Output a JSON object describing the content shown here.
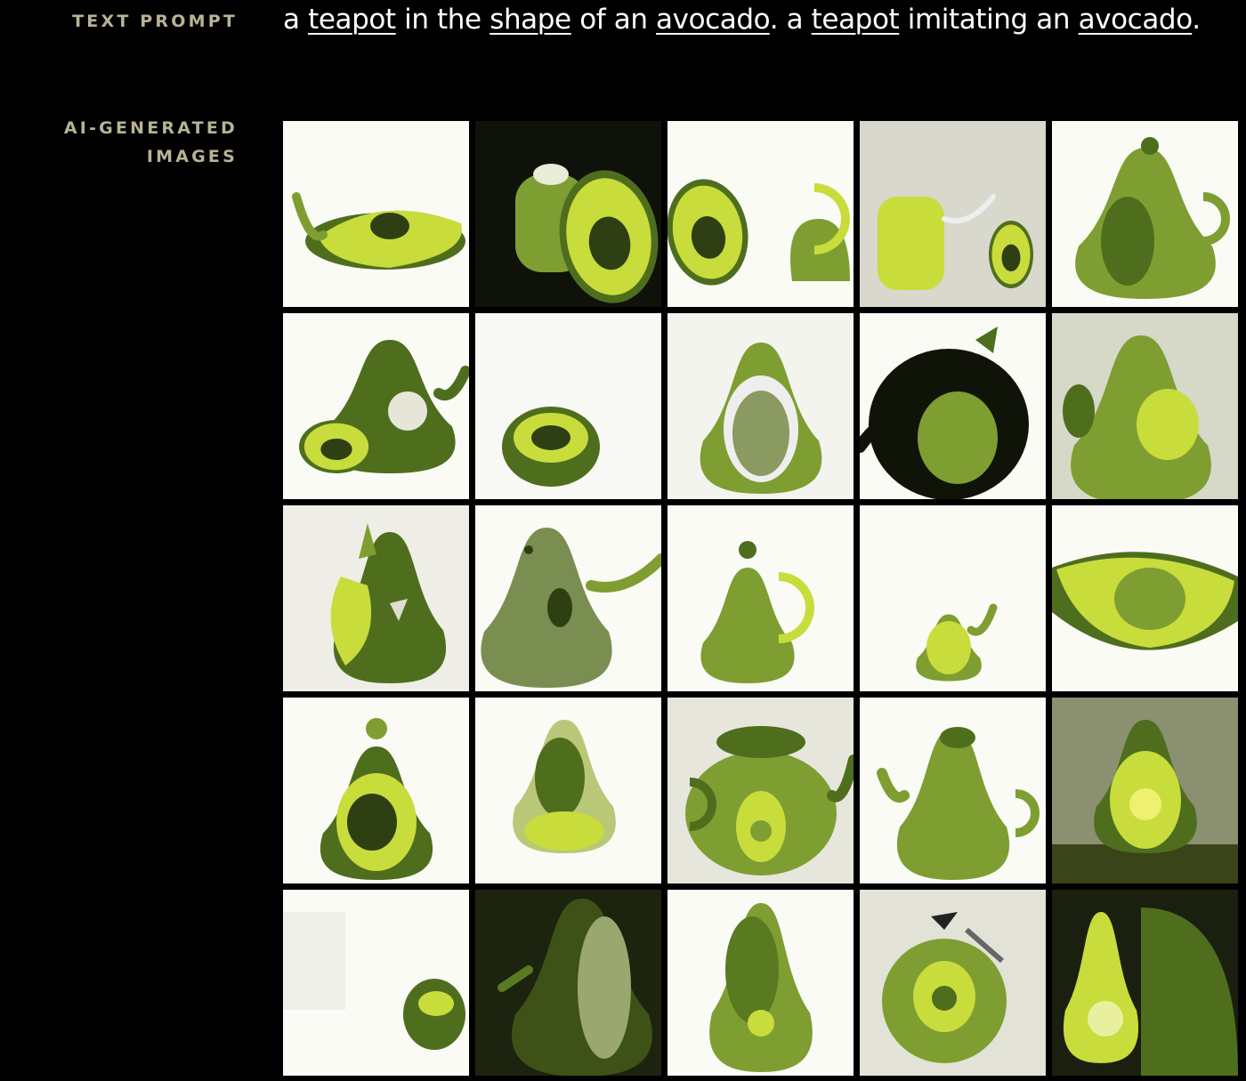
{
  "labels": {
    "text_prompt": "TEXT PROMPT",
    "ai_generated_line1": "AI-GENERATED",
    "ai_generated_line2": "IMAGES"
  },
  "prompt": {
    "tokens": [
      {
        "text": "a ",
        "link": false
      },
      {
        "text": "teapot",
        "link": true
      },
      {
        "text": " in the ",
        "link": false
      },
      {
        "text": "shape",
        "link": true
      },
      {
        "text": " of an ",
        "link": false
      },
      {
        "text": "avocado",
        "link": true
      },
      {
        "text": ". a ",
        "link": false
      },
      {
        "text": "teapot",
        "link": true
      },
      {
        "text": " imitating an ",
        "link": false
      },
      {
        "text": "avocado",
        "link": true
      },
      {
        "text": ".",
        "link": false
      }
    ]
  },
  "colors": {
    "background": "#000000",
    "label": "#b7b394",
    "prompt_text": "#ffffff",
    "avocado_light": "#c8dc3c",
    "avocado_mid": "#7e9e32",
    "avocado_dark": "#4e6e1e",
    "pit": "#2f3f14"
  },
  "images": [
    {
      "bg": "#fbfbf6",
      "variant": "flat-teapot"
    },
    {
      "bg": "#0e120a",
      "variant": "half-avocado-with-pot"
    },
    {
      "bg": "#fbfbf6",
      "variant": "split-avocado-handle"
    },
    {
      "bg": "#d9d8cc",
      "variant": "kettle-and-half"
    },
    {
      "bg": "#fbfbf6",
      "variant": "tall-pot-lid"
    },
    {
      "bg": "#fbfbf6",
      "variant": "pot-with-half"
    },
    {
      "bg": "#f8f8f4",
      "variant": "round-cup"
    },
    {
      "bg": "#f4f4ee",
      "variant": "open-shell"
    },
    {
      "bg": "#fbfbf6",
      "variant": "dark-teapot"
    },
    {
      "bg": "#d6d8c8",
      "variant": "gourd-vase"
    },
    {
      "bg": "#eeeee6",
      "variant": "leaf-pot"
    },
    {
      "bg": "#fbfbf6",
      "variant": "lumpy-spout"
    },
    {
      "bg": "#fbfbf6",
      "variant": "pear-handle"
    },
    {
      "bg": "#fbfbf6",
      "variant": "small-spout"
    },
    {
      "bg": "#fbfbf6",
      "variant": "bowl-half"
    },
    {
      "bg": "#fbfbf6",
      "variant": "jar-lid"
    },
    {
      "bg": "#fbfbf6",
      "variant": "egg-shell"
    },
    {
      "bg": "#e6e6dc",
      "variant": "big-teapot"
    },
    {
      "bg": "#fbfbf6",
      "variant": "glossy-pear"
    },
    {
      "bg": "#8a9070",
      "variant": "standing-half"
    },
    {
      "bg": "#fbfbf6",
      "variant": "small-ball"
    },
    {
      "bg": "#1c2410",
      "variant": "dark-jug"
    },
    {
      "bg": "#fbfbf6",
      "variant": "whole-avocado"
    },
    {
      "bg": "#e2e2d6",
      "variant": "textured-ball"
    },
    {
      "bg": "#1a1f10",
      "variant": "pear-with-shell"
    }
  ]
}
